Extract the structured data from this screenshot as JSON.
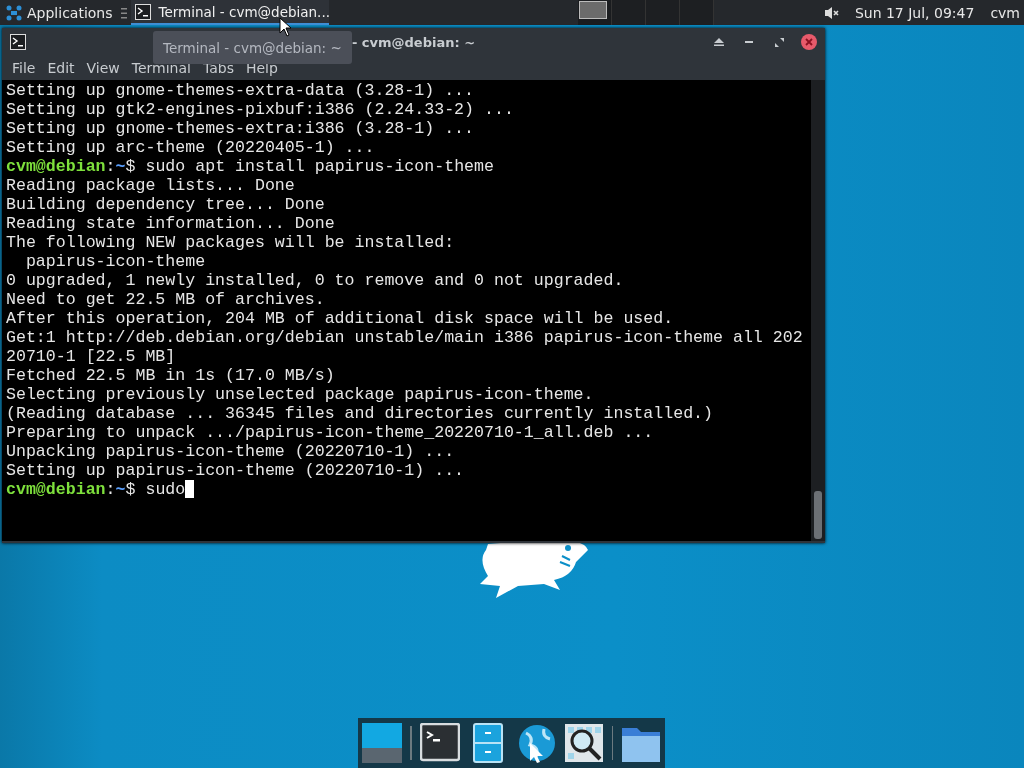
{
  "panel": {
    "applications_label": "Applications",
    "task": {
      "label": "Terminal - cvm@debian...",
      "selected": true
    },
    "workspaces": [
      {
        "selected": true
      },
      {
        "selected": false
      },
      {
        "selected": false
      },
      {
        "selected": false
      }
    ],
    "muted": true,
    "clock": "Sun 17 Jul, 09:47",
    "user": "cvm"
  },
  "tooltip": "Terminal - cvm@debian: ~",
  "window": {
    "title": "- cvm@debian: ~",
    "menu": [
      "File",
      "Edit",
      "View",
      "Terminal",
      "Tabs",
      "Help"
    ],
    "lines": [
      {
        "kind": "output",
        "text": "Setting up gnome-themes-extra-data (3.28-1) ..."
      },
      {
        "kind": "output",
        "text": "Setting up gtk2-engines-pixbuf:i386 (2.24.33-2) ..."
      },
      {
        "kind": "output",
        "text": "Setting up gnome-themes-extra:i386 (3.28-1) ..."
      },
      {
        "kind": "output",
        "text": "Setting up arc-theme (20220405-1) ..."
      },
      {
        "kind": "prompt",
        "user": "cvm@debian",
        "colon": ":",
        "path": "~",
        "command": "$ sudo apt install papirus-icon-theme",
        "cursor": false
      },
      {
        "kind": "output",
        "text": "Reading package lists... Done"
      },
      {
        "kind": "output",
        "text": "Building dependency tree... Done"
      },
      {
        "kind": "output",
        "text": "Reading state information... Done"
      },
      {
        "kind": "output",
        "text": "The following NEW packages will be installed:"
      },
      {
        "kind": "output",
        "text": "  papirus-icon-theme"
      },
      {
        "kind": "output",
        "text": "0 upgraded, 1 newly installed, 0 to remove and 0 not upgraded."
      },
      {
        "kind": "output",
        "text": "Need to get 22.5 MB of archives."
      },
      {
        "kind": "output",
        "text": "After this operation, 204 MB of additional disk space will be used."
      },
      {
        "kind": "output",
        "text": "Get:1 http://deb.debian.org/debian unstable/main i386 papirus-icon-theme all 202"
      },
      {
        "kind": "output",
        "text": "20710-1 [22.5 MB]"
      },
      {
        "kind": "output",
        "text": "Fetched 22.5 MB in 1s (17.0 MB/s)"
      },
      {
        "kind": "output",
        "text": "Selecting previously unselected package papirus-icon-theme."
      },
      {
        "kind": "output",
        "text": "(Reading database ... 36345 files and directories currently installed.)"
      },
      {
        "kind": "output",
        "text": "Preparing to unpack .../papirus-icon-theme_20220710-1_all.deb ..."
      },
      {
        "kind": "output",
        "text": "Unpacking papirus-icon-theme (20220710-1) ..."
      },
      {
        "kind": "output",
        "text": "Setting up papirus-icon-theme (20220710-1) ..."
      },
      {
        "kind": "prompt",
        "user": "cvm@debian",
        "colon": ":",
        "path": "~",
        "command": "$ sudo",
        "cursor": true
      }
    ]
  },
  "dock": [
    {
      "kind": "desktop"
    },
    {
      "kind": "separator"
    },
    {
      "kind": "terminal"
    },
    {
      "kind": "files"
    },
    {
      "kind": "browser"
    },
    {
      "kind": "search"
    },
    {
      "kind": "separator"
    },
    {
      "kind": "folder"
    }
  ]
}
